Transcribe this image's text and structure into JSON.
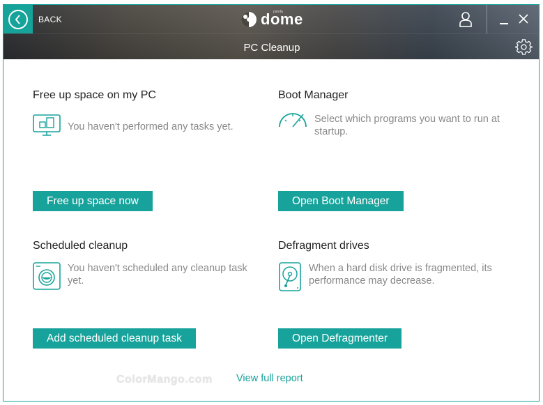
{
  "header": {
    "back_label": "BACK",
    "brand": "dome",
    "brand_super": "panda",
    "title": "PC Cleanup",
    "accent_color": "#17a39b"
  },
  "icons": {
    "back": "chevron-left-icon",
    "user": "user-icon",
    "minimize": "minimize-icon",
    "close": "close-icon",
    "settings": "gear-icon"
  },
  "sections": {
    "free_space": {
      "title": "Free up space on my PC",
      "desc": "You haven't performed any tasks yet.",
      "button": "Free up space now"
    },
    "boot": {
      "title": "Boot Manager",
      "desc_line1": "Select which programs you want to run at",
      "desc_line2": "startup.",
      "button": "Open Boot Manager"
    },
    "scheduled": {
      "title": "Scheduled cleanup",
      "desc_line1": "You haven't scheduled any cleanup task",
      "desc_line2": "yet.",
      "button": "Add scheduled cleanup task"
    },
    "defrag": {
      "title": "Defragment drives",
      "desc_line1": "When a hard disk drive is fragmented, its",
      "desc_line2": "performance may decrease.",
      "button": "Open Defragmenter"
    }
  },
  "footer": {
    "link": "View full report",
    "watermark": "ColorMango.com"
  }
}
